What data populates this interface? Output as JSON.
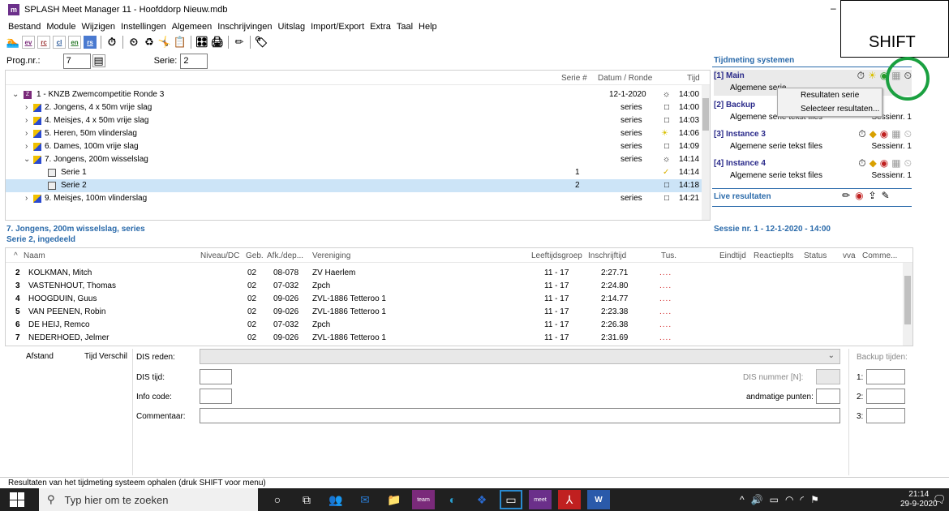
{
  "window": {
    "title": "SPLASH Meet Manager 11 - Hoofddorp Nieuw.mdb",
    "logo": "m",
    "minimize": "–"
  },
  "overlay": {
    "shift_label": "SHIFT"
  },
  "menu": [
    "Bestand",
    "Module",
    "Wijzigen",
    "Instellingen",
    "Algemeen",
    "Inschrijvingen",
    "Uitslag",
    "Import/Export",
    "Extra",
    "Taal",
    "Help"
  ],
  "toolbar": {
    "ev": "ev",
    "rc": "rc",
    "cl": "cl",
    "en": "en",
    "rs": "rs"
  },
  "prog": {
    "label": "Prog.nr.:",
    "value": "7",
    "serie_label": "Serie:",
    "serie_value": "2"
  },
  "tree": {
    "headers": {
      "serie": "Serie #",
      "datum": "Datum / Ronde",
      "tijd": "Tijd"
    },
    "rows": [
      {
        "label": "1 - KNZB Zwemcompetitie Ronde 3",
        "serie": "",
        "datum": "12-1-2020",
        "tijd": "14:00"
      },
      {
        "label": "2. Jongens, 4 x 50m vrije slag",
        "serie": "",
        "datum": "series",
        "tijd": "14:00"
      },
      {
        "label": "4. Meisjes, 4 x 50m vrije slag",
        "serie": "",
        "datum": "series",
        "tijd": "14:03"
      },
      {
        "label": "5. Heren, 50m vlinderslag",
        "serie": "",
        "datum": "series",
        "tijd": "14:06"
      },
      {
        "label": "6. Dames, 100m vrije slag",
        "serie": "",
        "datum": "series",
        "tijd": "14:09"
      },
      {
        "label": "7. Jongens, 200m wisselslag",
        "serie": "",
        "datum": "series",
        "tijd": "14:14"
      },
      {
        "label": "Serie 1",
        "serie": "1",
        "datum": "",
        "tijd": "14:14"
      },
      {
        "label": "Serie 2",
        "serie": "2",
        "datum": "",
        "tijd": "14:18"
      },
      {
        "label": "9. Meisjes, 100m vlinderslag",
        "serie": "",
        "datum": "series",
        "tijd": "14:21"
      }
    ]
  },
  "timing": {
    "title": "Tijdmeting systemen",
    "instances": [
      {
        "name": "[1] Main",
        "sub": "Algemene serie",
        "session": ""
      },
      {
        "name": "[2] Backup",
        "sub": "Algemene serie tekst files",
        "session": "Sessienr. 1"
      },
      {
        "name": "[3] Instance 3",
        "sub": "Algemene serie tekst files",
        "session": "Sessienr. 1"
      },
      {
        "name": "[4] Instance 4",
        "sub": "Algemene serie tekst files",
        "session": "Sessienr. 1"
      }
    ],
    "live": "Live resultaten",
    "popup": [
      "Resultaten serie",
      "Selecteer resultaten..."
    ]
  },
  "event": {
    "title": "7. Jongens, 200m wisselslag, series",
    "subtitle": "Serie 2, ingedeeld",
    "session": "Sessie nr. 1 - 12-1-2020 - 14:00"
  },
  "grid": {
    "headers": {
      "naam": "Naam",
      "niveau": "Niveau/DC",
      "geb": "Geb.",
      "afk": "Afk./dep...",
      "vereniging": "Vereniging",
      "leeftijd": "Leeftijdsgroep",
      "inschrijf": "Inschrijftijd",
      "tus": "Tus.",
      "eind": "Eindtijd",
      "reactie": "Reactie",
      "plts": "plts",
      "status": "Status",
      "vva": "vva",
      "comm": "Comme..."
    },
    "rows": [
      {
        "lane": "2",
        "naam": "KOLKMAN, Mitch",
        "geb": "02",
        "afk": "08-078",
        "ver": "ZV Haerlem",
        "lg": "11 - 17",
        "it": "2:27.71",
        "tus": "...."
      },
      {
        "lane": "3",
        "naam": "VASTENHOUT, Thomas",
        "geb": "02",
        "afk": "07-032",
        "ver": "Zpch",
        "lg": "11 - 17",
        "it": "2:24.80",
        "tus": "...."
      },
      {
        "lane": "4",
        "naam": "HOOGDUIN, Guus",
        "geb": "02",
        "afk": "09-026",
        "ver": "ZVL-1886 Tetteroo 1",
        "lg": "11 - 17",
        "it": "2:14.77",
        "tus": "...."
      },
      {
        "lane": "5",
        "naam": "VAN PEENEN, Robin",
        "geb": "02",
        "afk": "09-026",
        "ver": "ZVL-1886 Tetteroo 1",
        "lg": "11 - 17",
        "it": "2:23.38",
        "tus": "...."
      },
      {
        "lane": "6",
        "naam": "DE HEIJ, Remco",
        "geb": "02",
        "afk": "07-032",
        "ver": "Zpch",
        "lg": "11 - 17",
        "it": "2:26.38",
        "tus": "...."
      },
      {
        "lane": "7",
        "naam": "NEDERHOED, Jelmer",
        "geb": "02",
        "afk": "09-026",
        "ver": "ZVL-1886 Tetteroo 1",
        "lg": "11 - 17",
        "it": "2:31.69",
        "tus": "...."
      }
    ]
  },
  "splits": {
    "afstand": "Afstand",
    "tijd": "Tijd",
    "verschil": "Verschil"
  },
  "dis": {
    "reden": "DIS reden:",
    "tijd": "DIS tijd:",
    "info": "Info code:",
    "comm": "Commentaar:",
    "nummer": "DIS nummer [N]:",
    "punten": "andmatige punten:"
  },
  "backup": {
    "title": "Backup tijden:",
    "l1": "1:",
    "l2": "2:",
    "l3": "3:"
  },
  "status": "Resultaten van het tijdmeting systeem ophalen (druk SHIFT voor menu)",
  "taskbar": {
    "search": "Typ hier om te zoeken",
    "time": "21:14",
    "date": "29-9-2020"
  }
}
